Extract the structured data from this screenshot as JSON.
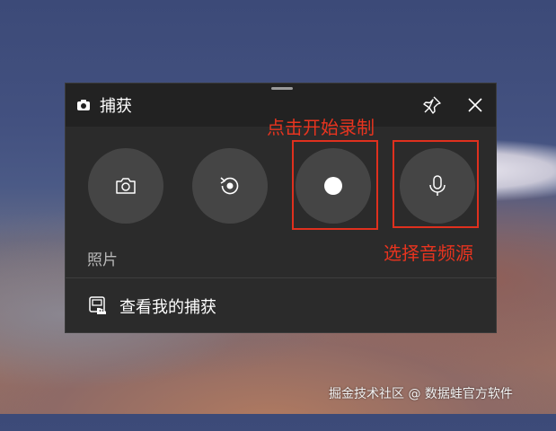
{
  "capture_panel": {
    "title": "捕获",
    "title_icon": "camera-icon",
    "pin_icon": "pin-icon",
    "close_icon": "close-icon",
    "buttons": [
      {
        "name": "screenshot",
        "icon": "camera-icon"
      },
      {
        "name": "recent-activity",
        "icon": "replay-icon"
      },
      {
        "name": "start-recording",
        "icon": "record-dot-icon"
      },
      {
        "name": "microphone",
        "icon": "microphone-icon"
      }
    ],
    "mode_label": "照片",
    "gallery_label": "查看我的捕获",
    "gallery_icon": "gallery-icon"
  },
  "annotations": {
    "record_hint": "点击开始录制",
    "mic_hint": "选择音频源",
    "color": "#e0301e"
  },
  "watermark": "掘金技术社区 @ 数据蛙官方软件"
}
